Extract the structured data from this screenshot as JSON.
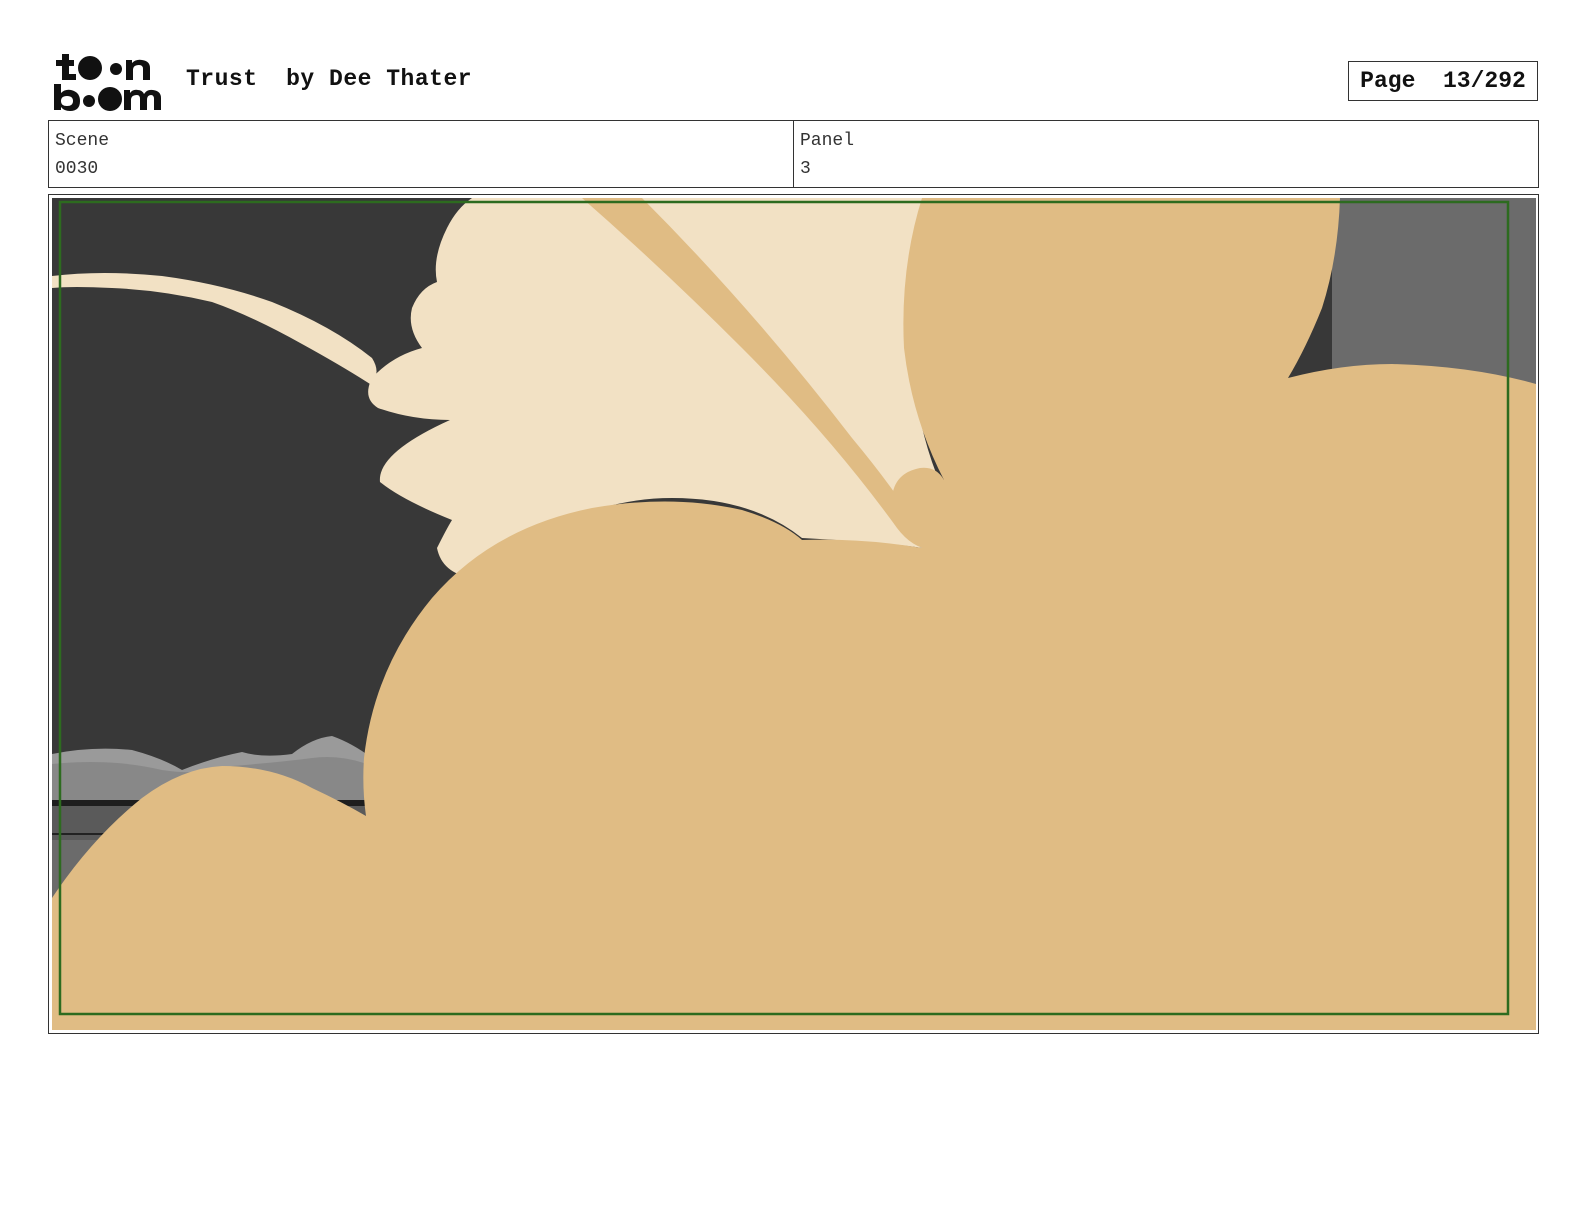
{
  "header": {
    "logo_text": "toonboom",
    "title": "Trust  by Dee Thater",
    "page": "Page  13/292"
  },
  "info": {
    "scene_label": "Scene",
    "scene_value": "0030",
    "panel_label": "Panel",
    "panel_value": "3"
  },
  "colors": {
    "background_dark": "#383838",
    "skin_light": "#f2e1c4",
    "skin_tan": "#e0bc84",
    "gray_right": "#6b6b6b",
    "safe_frame": "#2d6b1f"
  }
}
